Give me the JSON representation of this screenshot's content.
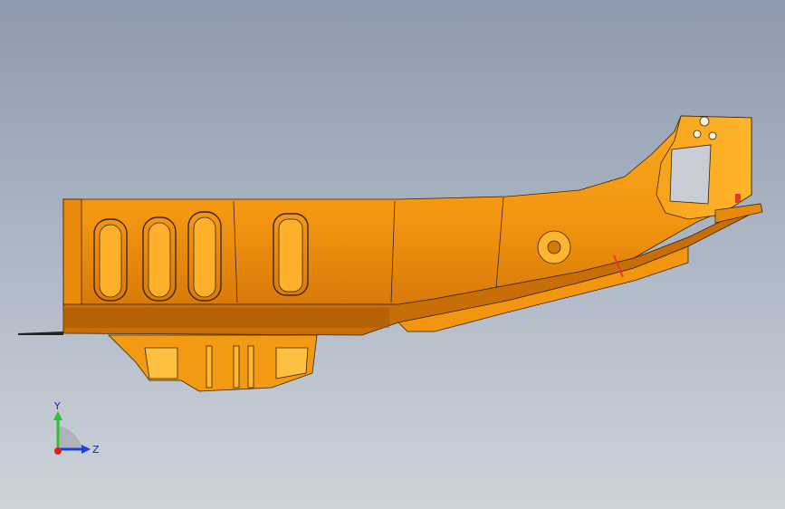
{
  "viewport": {
    "part_color": "#f59a12",
    "part_highlight": "#ffb62a",
    "part_shadow": "#b8640a",
    "edge_color": "#3a2400",
    "background_top": "#8e9aad",
    "background_bottom": "#cdd3da"
  },
  "triad": {
    "y_label": "Y",
    "z_label": "Z",
    "y_axis_color": "#2fbf2f",
    "z_axis_color": "#1f3fe0",
    "x_axis_color": "#e01f1f"
  }
}
